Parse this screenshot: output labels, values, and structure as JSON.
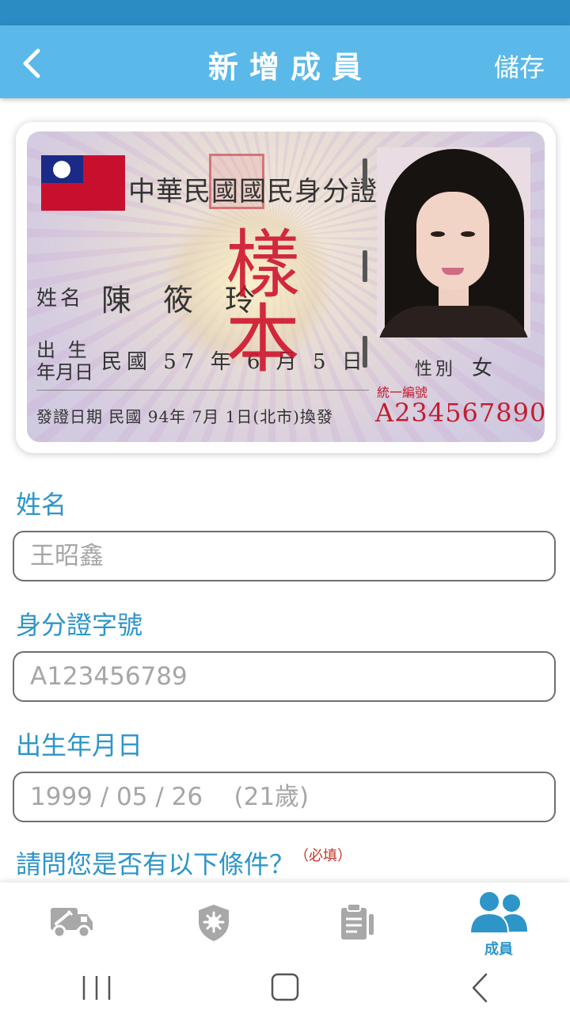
{
  "header": {
    "title": "新增成員",
    "save_label": "儲存",
    "back_icon": "chevron-left-icon"
  },
  "id_card": {
    "title": "中華民國國民身分證",
    "sample_mark": "樣本",
    "name_label": "姓名",
    "name_value": "陳筱玲",
    "birth_label_line1": "出 生",
    "birth_label_line2": "年月日",
    "birth_value": "民國 57 年 6 月 5 日",
    "sex_label": "性別",
    "sex_value": "女",
    "issue_text": "發證日期 民國 94年 7月 1日(北市)換發",
    "uid_label": "統一編號",
    "uid_value": "A234567890"
  },
  "form": {
    "name_label": "姓名",
    "name_placeholder": "王昭鑫",
    "id_label": "身分證字號",
    "id_placeholder": "A123456789",
    "birth_label": "出生年月日",
    "birth_placeholder": "1999 / 05 / 26    (21歲)",
    "question_label": "請問您是否有以下條件？",
    "required_mark": "（必填）"
  },
  "bottom_nav": {
    "items": [
      {
        "icon": "vaccine-truck-icon",
        "label": "",
        "active": false
      },
      {
        "icon": "shield-virus-icon",
        "label": "",
        "active": false
      },
      {
        "icon": "clipboard-icon",
        "label": "",
        "active": false
      },
      {
        "icon": "users-icon",
        "label": "成員",
        "active": true
      }
    ]
  },
  "colors": {
    "header_bg": "#5ab9e8",
    "status_bar": "#2b8cc4",
    "accent": "#2e95c8",
    "inactive_icon": "#a8a8a8",
    "required": "#c0392b"
  }
}
